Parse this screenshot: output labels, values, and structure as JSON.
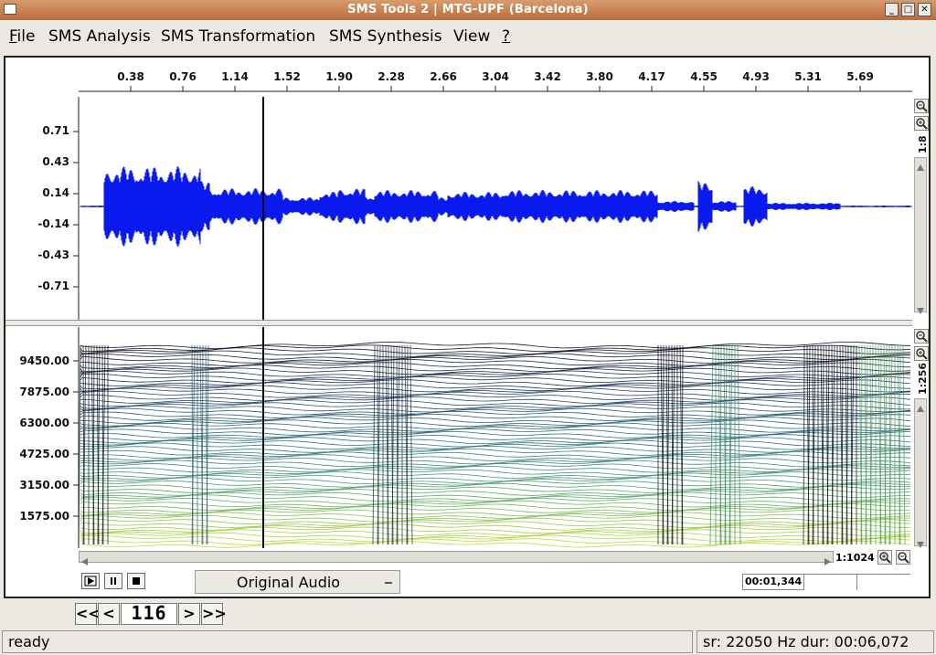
{
  "window": {
    "title": "SMS Tools 2 | MTG-UPF (Barcelona)",
    "buttons": {
      "minimize": "_",
      "maximize": "□",
      "close": "✕"
    }
  },
  "menu": [
    {
      "label": "File",
      "key": "F"
    },
    {
      "label": "SMS Analysis",
      "key": "A"
    },
    {
      "label": "SMS Transformation",
      "key": "T"
    },
    {
      "label": "SMS Synthesis",
      "key": "S"
    },
    {
      "label": "View",
      "key": "V"
    },
    {
      "label": "?",
      "key": "?"
    }
  ],
  "waveform": {
    "x_ticks": [
      "0.38",
      "0.76",
      "1.14",
      "1.52",
      "1.90",
      "2.28",
      "2.66",
      "3.04",
      "3.42",
      "3.80",
      "4.17",
      "4.55",
      "4.93",
      "5.31",
      "5.69"
    ],
    "y_ticks": [
      "0.71",
      "0.43",
      "0.14",
      "-0.14",
      "-0.43",
      "-0.71"
    ],
    "zoom_ratio": "1:8",
    "color": "#0a1aee"
  },
  "spectrum": {
    "y_ticks": [
      "9450.00",
      "7875.00",
      "6300.00",
      "4725.00",
      "3150.00",
      "1575.00"
    ],
    "zoom_ratio": "1:256"
  },
  "horizontal_zoom": "1:1024",
  "transport": {
    "play": "play-icon",
    "pause": "pause-icon",
    "stop": "stop-icon",
    "audio_source": "Original Audio",
    "time_display": "00:01,344"
  },
  "frame_nav": {
    "first": "<<",
    "prev": "<",
    "frame": "116",
    "next": ">",
    "last": ">>"
  },
  "status": {
    "message": "ready",
    "info": "sr: 22050 Hz  dur: 00:06,072"
  }
}
